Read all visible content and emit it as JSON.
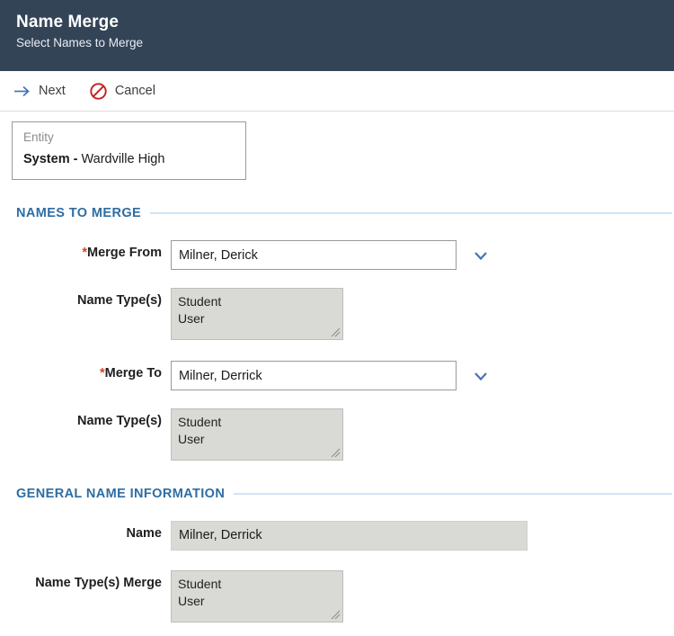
{
  "header": {
    "title": "Name Merge",
    "subtitle": "Select Names to Merge"
  },
  "toolbar": {
    "next_label": "Next",
    "next_icon": "arrow-right-icon",
    "cancel_label": "Cancel",
    "cancel_icon": "no-entry-icon"
  },
  "entity": {
    "label": "Entity",
    "value_bold": "System -",
    "value_rest": " Wardville High"
  },
  "sections": {
    "names_to_merge": "NAMES TO MERGE",
    "general_name_information": "GENERAL NAME INFORMATION"
  },
  "form": {
    "merge_from": {
      "label": "Merge From",
      "required_marker": "*",
      "value": "Milner, Derick",
      "placeholder": "",
      "dropdown_icon": "chevron-down-icon"
    },
    "merge_from_name_types": {
      "label": "Name Type(s)",
      "lines": [
        "Student",
        "User"
      ]
    },
    "merge_to": {
      "label": "Merge To",
      "required_marker": "*",
      "value": "Milner, Derrick",
      "placeholder": "",
      "dropdown_icon": "chevron-down-icon"
    },
    "merge_to_name_types": {
      "label": "Name Type(s)",
      "lines": [
        "Student",
        "User"
      ]
    },
    "name": {
      "label": "Name",
      "value": "Milner, Derrick"
    },
    "name_types_merge": {
      "label": "Name Type(s) Merge",
      "lines": [
        "Student",
        "User"
      ]
    }
  },
  "colors": {
    "header_bg": "#344457",
    "section_blue": "#2e6da4",
    "rule_blue": "#cfe4f5",
    "required_red": "#d9441f",
    "accent_blue": "#4573b8",
    "cancel_red": "#c0211f",
    "readonly_bg": "#d9d9d6"
  }
}
